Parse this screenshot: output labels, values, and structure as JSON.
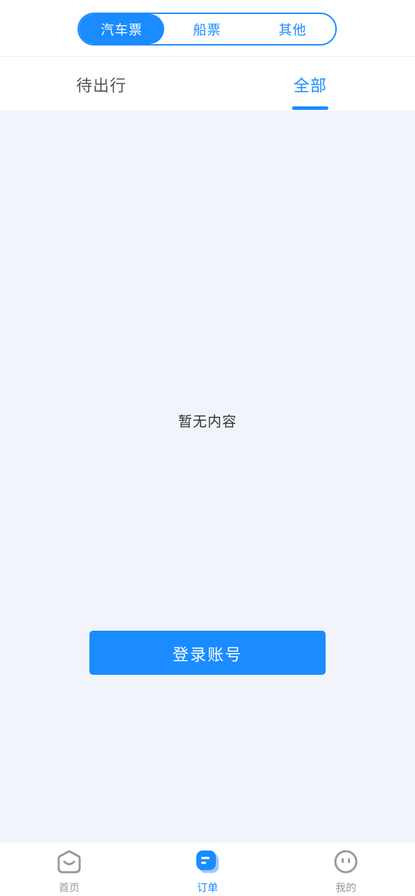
{
  "segment_tabs": [
    {
      "label": "汽车票",
      "active": true
    },
    {
      "label": "船票",
      "active": false
    },
    {
      "label": "其他",
      "active": false
    }
  ],
  "sub_tabs": {
    "pending": "待出行",
    "all": "全部",
    "active": "all"
  },
  "content": {
    "empty_text": "暂无内容",
    "login_button": "登录账号"
  },
  "bottom_nav": {
    "home": {
      "label": "首页",
      "icon": "home-icon"
    },
    "orders": {
      "label": "订单",
      "icon": "orders-icon",
      "active": true
    },
    "mine": {
      "label": "我的",
      "icon": "profile-icon"
    }
  },
  "colors": {
    "accent": "#1a8cff",
    "background": "#f1f5fb",
    "inactive_text": "#999999"
  }
}
